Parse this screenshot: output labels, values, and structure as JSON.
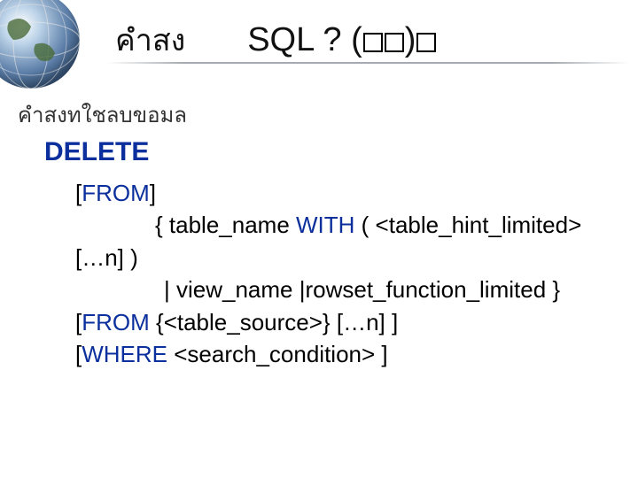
{
  "title": {
    "thai": "คำสง",
    "sql_prefix": "SQL ? (",
    "sql_mid_close": ")",
    "sql_suffix": ""
  },
  "subtitle": "คำสงทใชลบขอมล",
  "keyword_delete": "DELETE",
  "syntax": {
    "line1_open": "[",
    "line1_from": "FROM",
    "line1_close": "]",
    "line2_a": "{ table_name ",
    "line2_with": "WITH",
    "line2_b": " ( <table_hint_limited>",
    "line3": "[…n] )",
    "line4": "| view_name |rowset_function_limited }",
    "line5_open": "[",
    "line5_from": "FROM",
    "line5_rest": " {<table_source>} […n] ]",
    "line6_open": "[",
    "line6_where": "WHERE",
    "line6_rest": " <search_condition> ]"
  }
}
